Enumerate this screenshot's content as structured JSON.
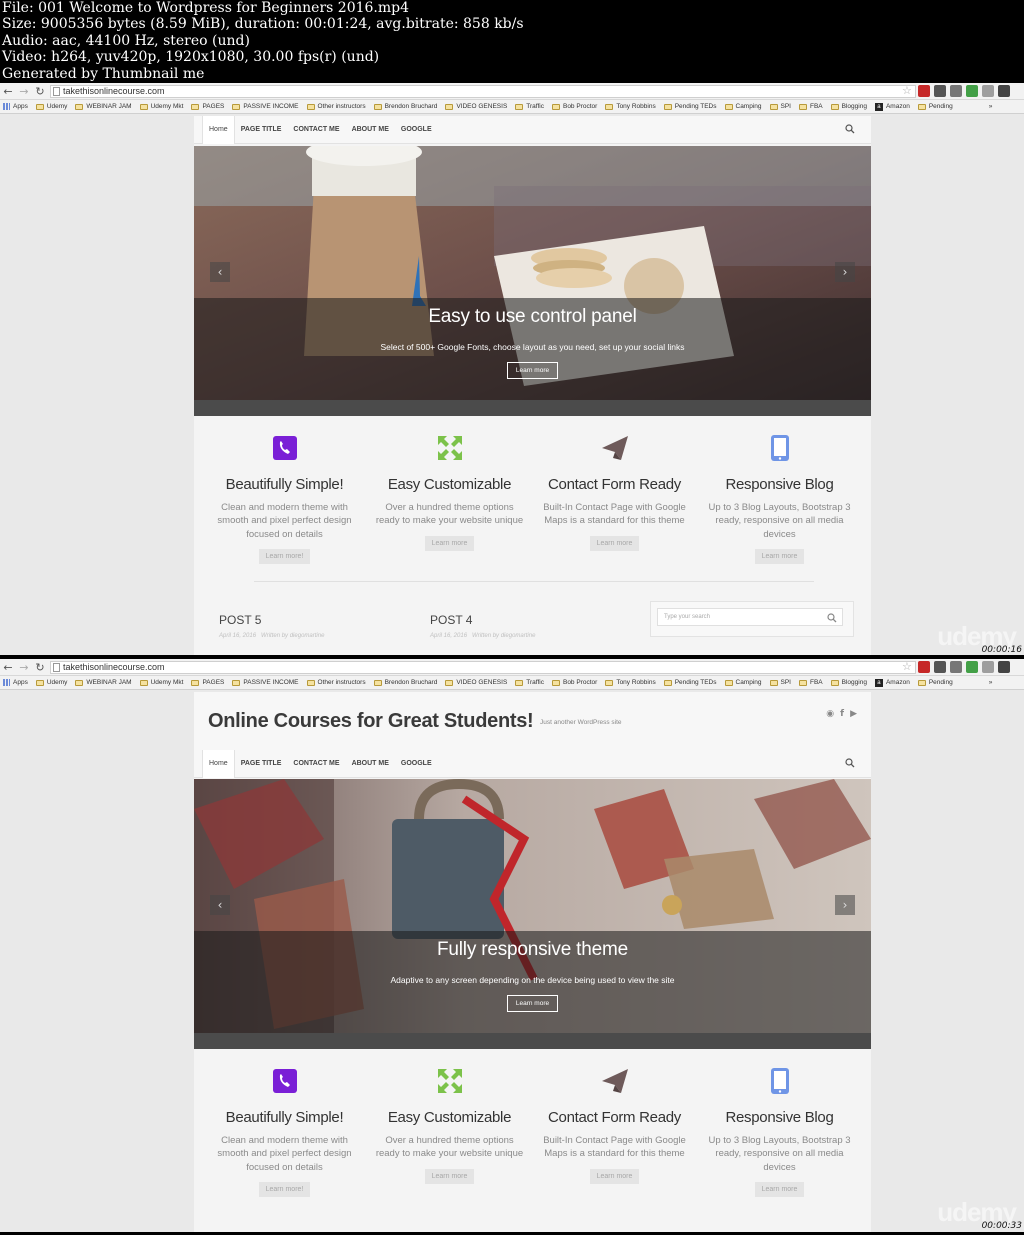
{
  "info": {
    "line1": "File: 001 Welcome to Wordpress for Beginners 2016.mp4",
    "line2": "Size: 9005356 bytes (8.59 MiB), duration: 00:01:24, avg.bitrate: 858 kb/s",
    "line3": "Audio: aac, 44100 Hz, stereo (und)",
    "line4": "Video: h264, yuv420p, 1920x1080, 30.00 fps(r) (und)",
    "line5": "Generated by Thumbnail me"
  },
  "browser": {
    "url": "takethisonlinecourse.com",
    "back_icon": "back-arrow-icon",
    "forward_icon": "forward-arrow-icon",
    "reload_icon": "reload-icon",
    "bookmarks": [
      "Apps",
      "Udemy",
      "WEBINAR JAM",
      "Udemy Mkt",
      "PAGES",
      "PASSIVE INCOME",
      "Other instructors",
      "Brendon Bruchard",
      "VIDEO GENESIS",
      "Traffic",
      "Bob Proctor",
      "Tony Robbins",
      "Pending TEDs",
      "Camping",
      "SPI",
      "FBA",
      "Blogging",
      "Amazon",
      "Pending"
    ],
    "overflow": "»"
  },
  "site": {
    "title": "Online Courses for Great Students!",
    "tagline": "Just another WordPress site",
    "nav": [
      "Home",
      "PAGE TITLE",
      "CONTACT ME",
      "ABOUT ME",
      "GOOGLE"
    ],
    "learn_more": "Learn more",
    "features": [
      {
        "title": "Beautifully Simple!",
        "text": "Clean and modern theme with smooth and pixel perfect design focused on details",
        "button": "Learn more!",
        "icon": "phone-icon",
        "color": "#7a1fd6"
      },
      {
        "title": "Easy Customizable",
        "text": "Over a hundred theme options ready to make your website unique",
        "button": "Learn more",
        "icon": "expand-arrows-icon",
        "color": "#7cc24a"
      },
      {
        "title": "Contact Form Ready",
        "text": "Built-In Contact Page with Google Maps is a standard for this theme",
        "button": "Learn more",
        "icon": "paper-plane-icon",
        "color": "#6e5a5a"
      },
      {
        "title": "Responsive Blog",
        "text": "Up to 3 Blog Layouts, Bootstrap 3 ready, responsive on all media devices",
        "button": "Learn more",
        "icon": "tablet-icon",
        "color": "#6f95e6"
      }
    ],
    "posts": [
      {
        "title": "POST 5",
        "date": "April 16, 2016",
        "author": "Written by diegomartine"
      },
      {
        "title": "POST 4",
        "date": "April 16, 2016",
        "author": "Written by diegomartine"
      }
    ],
    "search_placeholder": "Type your search"
  },
  "frames": [
    {
      "slide_title": "Easy to use control panel",
      "slide_text": "Select of 500+ Google Fonts, choose layout as you need, set up your social links",
      "timecode": "00:00:16"
    },
    {
      "slide_title": "Fully responsive theme",
      "slide_text": "Adaptive to any screen depending on the device being used to view the site",
      "timecode": "00:00:33"
    }
  ],
  "watermark": "udemy"
}
